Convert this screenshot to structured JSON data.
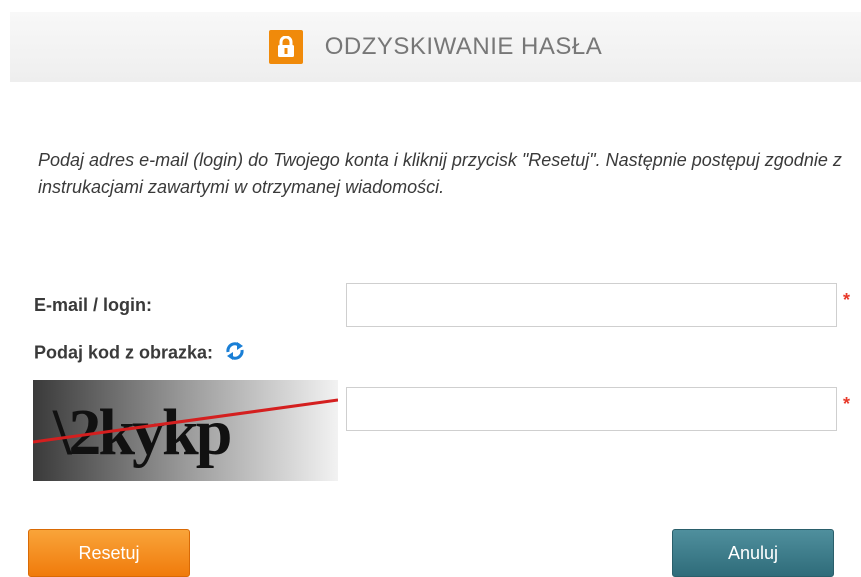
{
  "header": {
    "title": "ODZYSKIWANIE HASŁA",
    "icon": "lock-icon",
    "accent": "#f08a0a"
  },
  "intro": {
    "text": "Podaj adres e-mail (login) do Twojego konta i kliknij przycisk \"Resetuj\". Następnie postępuj zgodnie z instrukacjami zawartymi w otrzymanej wiadomości."
  },
  "form": {
    "email_label": "E-mail / login:",
    "email_value": "",
    "captcha_label": "Podaj kod z obrazka:",
    "captcha_value": "",
    "required_mark": "*",
    "captcha_image_text": "\\2kykp"
  },
  "buttons": {
    "reset": "Resetuj",
    "cancel": "Anuluj"
  }
}
